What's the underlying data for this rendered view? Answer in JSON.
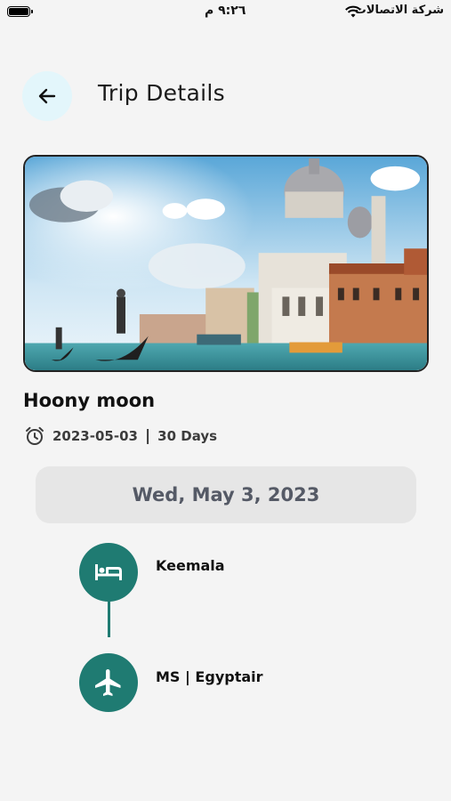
{
  "status_bar": {
    "time": "٩:٢٦ م",
    "carrier": "شركة الاتصالات"
  },
  "header": {
    "title": "Trip Details"
  },
  "trip": {
    "name": "Hoony moon",
    "date": "2023-05-03",
    "separator": "|",
    "duration": "30 Days"
  },
  "day": {
    "label": "Wed, May 3, 2023"
  },
  "timeline": {
    "items": [
      {
        "label": "Keemala",
        "icon": "bed-icon"
      },
      {
        "label": "MS | Egyptair",
        "icon": "airplane-icon"
      }
    ]
  },
  "colors": {
    "accent": "#1f7b72",
    "back_button_bg": "#e3f6fb",
    "date_pill_bg": "#e6e6e6",
    "background": "#f4f4f4"
  }
}
